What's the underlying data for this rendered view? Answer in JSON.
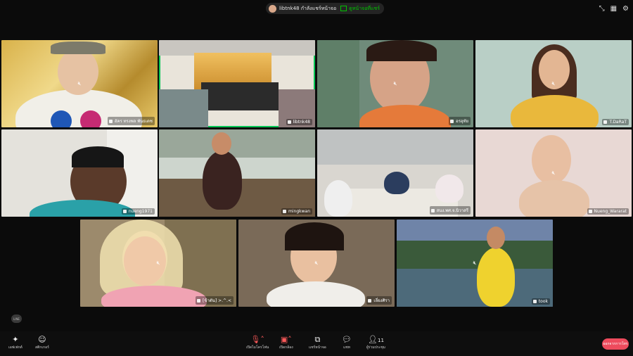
{
  "topbar": {
    "sharer_text": "libtnk48 กำลังแชร์หน้าจอ",
    "view_screen_label": "ดูหน้าจอที่แชร์",
    "icons": [
      "minimize-icon",
      "grid-view-icon",
      "settings-icon"
    ]
  },
  "tiles": [
    {
      "name": "อัคร ทรงพล พันธเดช",
      "muted": true
    },
    {
      "name": "libtnk48",
      "muted": false
    },
    {
      "name": "อรอุทัย",
      "muted": true
    },
    {
      "name": "T.DaRaT",
      "muted": true
    },
    {
      "name": "nueng1971",
      "muted": false
    },
    {
      "name": "mingkwan",
      "muted": false
    },
    {
      "name": "สนง.พศ.จ.นิวาสรี",
      "muted": false
    },
    {
      "name": "Nueng_Wararat",
      "muted": true
    },
    {
      "name": "[ข้าตัน] >.^.<",
      "muted": true
    },
    {
      "name": "เลี่ยงศิรา",
      "muted": true
    },
    {
      "name": "took",
      "muted": true
    }
  ],
  "bottombar": {
    "effects_label": "เอฟเฟกต์",
    "stickers_label": "สติกเกอร์",
    "mic_label": "เปิดไมโครโฟน",
    "camera_label": "เปิดกล้อง",
    "share_label": "แชร์หน้าจอ",
    "chat_label": "แชท",
    "participants_label": "ผู้ร่วมประชุม",
    "participants_count": "11",
    "end_label": "ออกจากการโทร"
  },
  "line_logo": "LINE"
}
